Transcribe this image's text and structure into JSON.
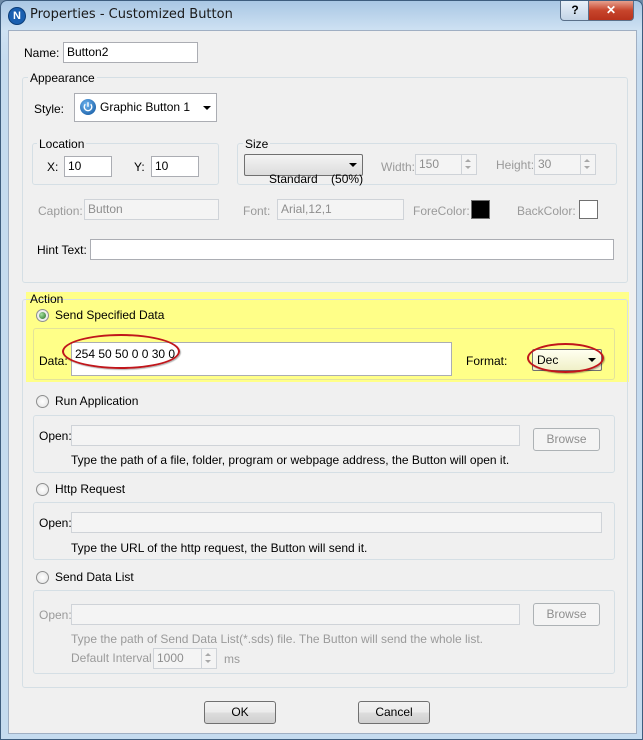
{
  "window": {
    "title": "Properties - Customized Button",
    "app_icon": "N",
    "help_label": "?",
    "close_label": "✕"
  },
  "name": {
    "label": "Name:",
    "value": "Button2"
  },
  "appearance": {
    "title": "Appearance",
    "style_label": "Style:",
    "style_value": "Graphic Button 1",
    "location": {
      "title": "Location",
      "x_label": "X:",
      "x_value": "10",
      "y_label": "Y:",
      "y_value": "10"
    },
    "size": {
      "title": "Size",
      "preset": "Standard    (50%)",
      "width_label": "Width:",
      "width_value": "150",
      "height_label": "Height:",
      "height_value": "30"
    },
    "caption_label": "Caption:",
    "caption_value": "Button",
    "font_label": "Font:",
    "font_value": "Arial,12,1",
    "forecolor_label": "ForeColor:",
    "forecolor": "#000000",
    "backcolor_label": "BackColor:",
    "backcolor": "#ffffff",
    "hint_label": "Hint Text:",
    "hint_value": ""
  },
  "action": {
    "title": "Action",
    "highlight_color": "#ffff88",
    "send_specified": {
      "label": "Send Specified Data",
      "checked": true,
      "data_label": "Data:",
      "data_value": "254 50 50 0 0 30 0",
      "format_label": "Format:",
      "format_value": "Dec"
    },
    "run_app": {
      "label": "Run Application",
      "open_label": "Open:",
      "open_value": "",
      "browse_label": "Browse",
      "hint": "Type the path of a file, folder, program or webpage address, the Button will open it."
    },
    "http": {
      "label": "Http Request",
      "open_label": "Open:",
      "open_value": "",
      "hint": "Type the URL of the http request, the Button will send it."
    },
    "data_list": {
      "label": "Send Data List",
      "open_label": "Open:",
      "open_value": "",
      "browse_label": "Browse",
      "hint": "Type the path of Send Data List(*.sds) file. The Button will send the whole list.",
      "interval_label": "Default Interval",
      "interval_value": "1000",
      "interval_unit": "ms"
    }
  },
  "footer": {
    "ok_label": "OK",
    "cancel_label": "Cancel"
  }
}
